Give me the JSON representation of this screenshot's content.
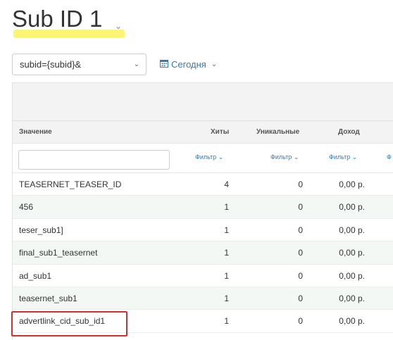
{
  "header": {
    "title": "Sub ID 1",
    "title_caret": "⌄"
  },
  "toolbar": {
    "select_value": "subid={subid}&",
    "select_caret": "⌄",
    "date_label": "Сегодня",
    "date_caret": "⌄"
  },
  "table": {
    "columns": {
      "name": "Значение",
      "hits": "Хиты",
      "unique": "Уникальные",
      "revenue": "Доход"
    },
    "filter_label": "Фильтр ⌄",
    "filter_label_partial": "Ф",
    "rows": [
      {
        "name": "TEASERNET_TEASER_ID",
        "hits": "4",
        "unique": "0",
        "revenue": "0,00 р."
      },
      {
        "name": "456",
        "hits": "1",
        "unique": "0",
        "revenue": "0,00 р."
      },
      {
        "name": "teser_sub1]",
        "hits": "1",
        "unique": "0",
        "revenue": "0,00 р."
      },
      {
        "name": "final_sub1_teasernet",
        "hits": "1",
        "unique": "0",
        "revenue": "0,00 р."
      },
      {
        "name": "ad_sub1",
        "hits": "1",
        "unique": "0",
        "revenue": "0,00 р."
      },
      {
        "name": "teasernet_sub1",
        "hits": "1",
        "unique": "0",
        "revenue": "0,00 р."
      },
      {
        "name": "advertlink_cid_sub_id1",
        "hits": "1",
        "unique": "0",
        "revenue": "0,00 р."
      }
    ]
  },
  "colors": {
    "highlight": "#fbf35a",
    "link": "#337ab7",
    "annotation_box": "#d32f2f",
    "alt_row": "#f4f8f4"
  }
}
